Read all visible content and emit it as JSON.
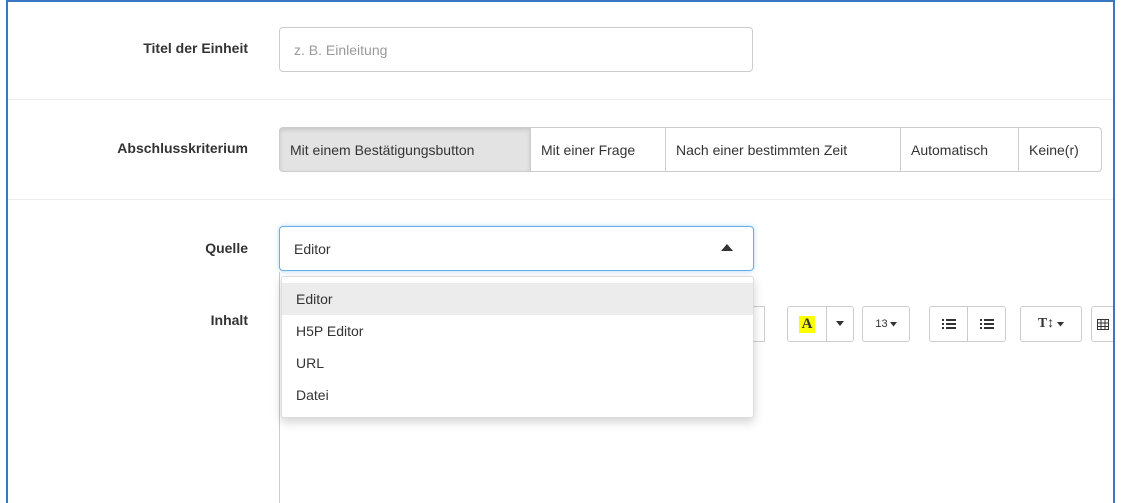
{
  "form": {
    "title_label": "Titel der Einheit",
    "title_placeholder": "z. B. Einleitung",
    "criterion_label": "Abschlusskriterium",
    "criterion_options": [
      "Mit einem Bestätigungsbutton",
      "Mit einer Frage",
      "Nach einer bestimmten Zeit",
      "Automatisch",
      "Keine(r)"
    ],
    "criterion_selected": "Mit einem Bestätigungsbutton",
    "source_label": "Quelle",
    "source_value": "Editor",
    "source_options": [
      "Editor",
      "H5P Editor",
      "URL",
      "Datei"
    ],
    "content_label": "Inhalt"
  },
  "toolbar": {
    "font_color_letter": "A",
    "font_size": "13",
    "line_height_glyph": "T↕",
    "icons": [
      "chevron-down-icon",
      "highlight-color-icon",
      "unordered-list-icon",
      "ordered-list-icon",
      "line-height-icon",
      "table-icon"
    ]
  },
  "colors": {
    "focus_border": "#66afe9",
    "active_segment": "#e3e3e3",
    "highlight_yellow": "#ffff00",
    "frame": "#3a78c4"
  }
}
